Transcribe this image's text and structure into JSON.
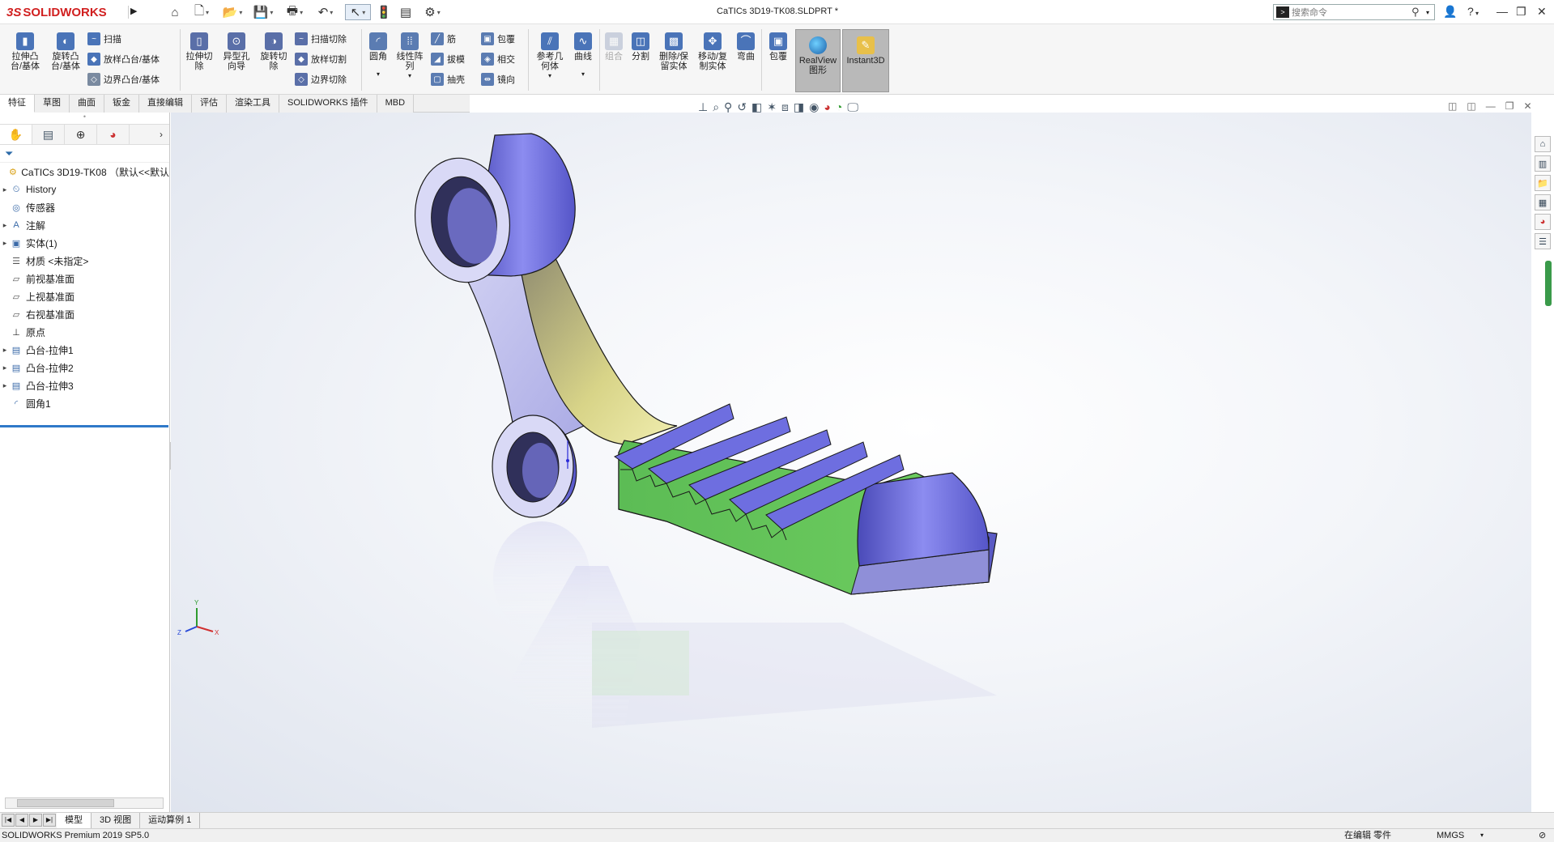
{
  "app": {
    "logo_ds": "3S",
    "logo_name": "SOLIDWORKS",
    "document_title": "CaTICs 3D19-TK08.SLDPRT *"
  },
  "search": {
    "placeholder": "搜索命令"
  },
  "window_controls": {
    "help": "?",
    "minimize": "—",
    "restore": "❐",
    "close": "✕"
  },
  "toolbar": {
    "extrude_boss": "拉伸凸\n台/基体",
    "revolve_boss": "旋转凸\n台/基体",
    "sweep": "扫描",
    "loft_boss": "放样凸台/基体",
    "boundary_boss": "边界凸台/基体",
    "extrude_cut": "拉伸切\n除",
    "hole_wizard": "异型孔\n向导",
    "revolve_cut": "旋转切\n除",
    "swept_cut": "扫描切除",
    "lofted_cut": "放样切割",
    "boundary_cut": "边界切除",
    "fillet": "圆角",
    "linear_pattern": "线性阵\n列",
    "rib": "筋",
    "draft": "拔模",
    "shell": "抽壳",
    "wrap": "包覆",
    "intersect": "相交",
    "mirror": "镜向",
    "ref_geometry": "参考几\n何体",
    "curves": "曲线",
    "combine": "组合",
    "split": "分割",
    "delete_keep_body": "删除/保\n留实体",
    "move_copy_body": "移动/复\n制实体",
    "flex": "弯曲",
    "wrap2": "包覆",
    "realview": "RealView\n图形",
    "instant3d": "Instant3D"
  },
  "tabs": [
    "特征",
    "草图",
    "曲面",
    "钣金",
    "直接编辑",
    "评估",
    "渲染工具",
    "SOLIDWORKS 插件",
    "MBD"
  ],
  "tree": {
    "root": "CaTICs 3D19-TK08 （默认<<默认",
    "items": [
      {
        "label": "History",
        "icon": "history-icon",
        "expandable": true
      },
      {
        "label": "传感器",
        "icon": "sensor-icon",
        "expandable": false
      },
      {
        "label": "注解",
        "icon": "annotation-icon",
        "expandable": true
      },
      {
        "label": "实体(1)",
        "icon": "solid-bodies-icon",
        "expandable": true
      },
      {
        "label": "材质 <未指定>",
        "icon": "material-icon",
        "expandable": false
      },
      {
        "label": "前视基准面",
        "icon": "plane-icon",
        "expandable": false
      },
      {
        "label": "上视基准面",
        "icon": "plane-icon",
        "expandable": false
      },
      {
        "label": "右视基准面",
        "icon": "plane-icon",
        "expandable": false
      },
      {
        "label": "原点",
        "icon": "origin-icon",
        "expandable": false
      },
      {
        "label": "凸台-拉伸1",
        "icon": "extrude-feature-icon",
        "expandable": true
      },
      {
        "label": "凸台-拉伸2",
        "icon": "extrude-feature-icon",
        "expandable": true
      },
      {
        "label": "凸台-拉伸3",
        "icon": "extrude-feature-icon",
        "expandable": true
      },
      {
        "label": "圆角1",
        "icon": "fillet-feature-icon",
        "expandable": false
      }
    ]
  },
  "bottom_tabs": [
    "模型",
    "3D 视图",
    "运动算例 1"
  ],
  "status": {
    "product": "SOLIDWORKS Premium 2019 SP5.0",
    "mode": "在编辑 零件",
    "units": "MMGS"
  },
  "triad": {
    "x": "X",
    "y": "Y",
    "z": "Z"
  },
  "colors": {
    "brand": "#d12020",
    "body_blue": "#6a6ad8",
    "face_green": "#63c25a",
    "face_yellow": "#c9c878",
    "accent_blue": "#2f79c9"
  }
}
